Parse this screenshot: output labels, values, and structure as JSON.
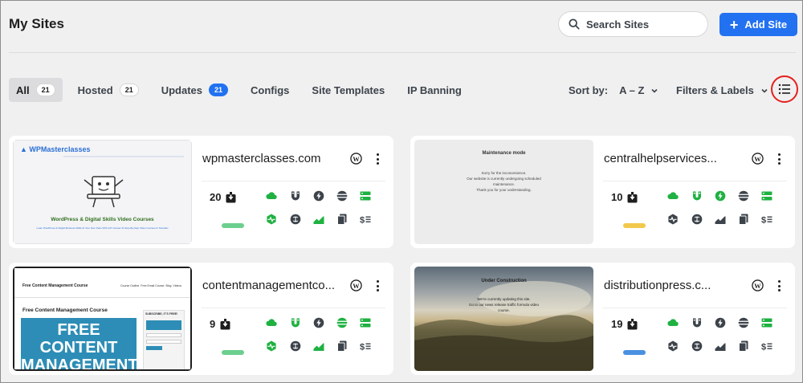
{
  "header": {
    "title": "My Sites",
    "search_placeholder": "Search Sites",
    "add_label": "Add Site"
  },
  "tabs": [
    {
      "label": "All",
      "count": "21"
    },
    {
      "label": "Hosted",
      "count": "21"
    },
    {
      "label": "Updates",
      "count": "21"
    },
    {
      "label": "Configs"
    },
    {
      "label": "Site Templates"
    },
    {
      "label": "IP Banning"
    }
  ],
  "toolbar": {
    "sort_label": "Sort by:",
    "sort_value": "A – Z",
    "filters_label": "Filters & Labels"
  },
  "colors": {
    "accent": "#2271f1",
    "green": "#1fb141",
    "gray_icon": "#3c434a",
    "highlight_ring": "#e4201b"
  },
  "sites": [
    {
      "name": "wpmasterclasses.com",
      "updates": "20",
      "status_color": "#6ccf8e",
      "thumb": {
        "brand": "WPMasterclasses",
        "headline": "WordPress & Digital Skills Video Courses",
        "subline": "Learn WordPress & Digital Business Skills At Your Own Pace With 24/7 Access To Step-By-Step Video Courses & Tutorials!"
      }
    },
    {
      "name": "centralhelpservices...",
      "updates": "10",
      "status_color": "#f2c94c",
      "thumb": {
        "headline": "Maintenance mode",
        "lines": [
          "Sorry for the inconvenience.",
          "Our website is currently undergoing scheduled",
          "maintenance.",
          "Thank you for your understanding."
        ]
      }
    },
    {
      "name": "contentmanagementco...",
      "updates": "9",
      "status_color": "#6ccf8e",
      "thumb": {
        "site_title": "Free Content Management Course",
        "nav": [
          "Course Outline",
          "Free Email Course",
          "Blog",
          "Videos"
        ],
        "heading": "Free Content Management Course",
        "big": "FREE CONTENT MANAGEMENT COURSE",
        "side_title": "SUBSCRIBE, IT'S FREE!"
      }
    },
    {
      "name": "distributionpress.c...",
      "updates": "19",
      "status_color": "#4a90e2",
      "thumb": {
        "headline": "Under Construction",
        "lines": [
          "We're currently updating this site.",
          "Go to our news release traffic formula video",
          "course."
        ]
      }
    }
  ]
}
